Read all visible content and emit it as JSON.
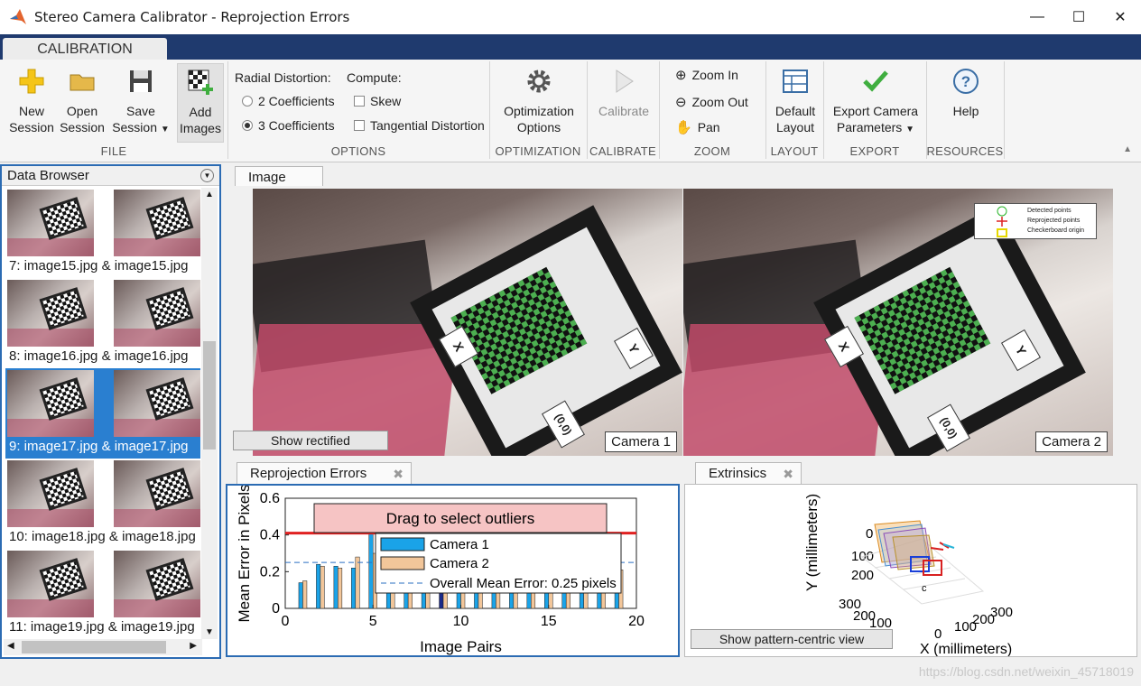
{
  "window": {
    "title": "Stereo Camera Calibrator - Reprojection Errors"
  },
  "tabs": {
    "calibration": "CALIBRATION"
  },
  "ribbon": {
    "new_session": [
      "New",
      "Session"
    ],
    "open_session": [
      "Open",
      "Session"
    ],
    "save_session": [
      "Save",
      "Session"
    ],
    "add_images": [
      "Add",
      "Images"
    ],
    "radial_label": "Radial Distortion:",
    "compute_label": "Compute:",
    "two_coeff": "2 Coefficients",
    "three_coeff": "3 Coefficients",
    "skew": "Skew",
    "tangential": "Tangential Distortion",
    "optimization": [
      "Optimization",
      "Options"
    ],
    "calibrate": "Calibrate",
    "zoom_in": "Zoom In",
    "zoom_out": "Zoom Out",
    "pan": "Pan",
    "default_layout": [
      "Default",
      "Layout"
    ],
    "export": [
      "Export Camera",
      "Parameters"
    ],
    "help": "Help",
    "sections": {
      "file": "FILE",
      "options": "OPTIONS",
      "optimization": "OPTIMIZATION",
      "calibrate": "CALIBRATE",
      "zoom": "ZOOM",
      "layout": "LAYOUT",
      "export": "EXPORT",
      "resources": "RESOURCES"
    },
    "selected_radial": "3 Coefficients"
  },
  "browser": {
    "title": "Data Browser",
    "items": [
      {
        "label": "7: image15.jpg & image15.jpg",
        "selected": false
      },
      {
        "label": "8: image16.jpg & image16.jpg",
        "selected": false
      },
      {
        "label": "9: image17.jpg & image17.jpg",
        "selected": true
      },
      {
        "label": "10: image18.jpg & image18.jpg",
        "selected": false
      },
      {
        "label": "11: image19.jpg & image19.jpg",
        "selected": false
      }
    ]
  },
  "image_panel": {
    "tab": "Image",
    "camera1": "Camera 1",
    "camera2": "Camera 2",
    "show_rectified": "Show rectified",
    "axis_x": "X",
    "axis_y": "Y",
    "origin": "(0,0)",
    "legend": [
      "Detected points",
      "Reprojected points",
      "Checkerboard origin"
    ]
  },
  "reprojection": {
    "tab": "Reprojection Errors",
    "drag_label": "Drag to select outliers"
  },
  "chart_data": {
    "type": "bar",
    "xlabel": "Image Pairs",
    "ylabel": "Mean Error in Pixels",
    "xlim": [
      0,
      20
    ],
    "ylim": [
      0,
      0.6
    ],
    "xticks": [
      0,
      5,
      10,
      15,
      20
    ],
    "yticks": [
      0,
      0.2,
      0.4,
      0.6
    ],
    "categories": [
      1,
      2,
      3,
      4,
      5,
      6,
      7,
      8,
      9,
      10,
      11,
      12,
      13,
      14,
      15,
      16,
      17,
      18,
      19
    ],
    "series": [
      {
        "name": "Camera 1",
        "color": "#1aa3e8",
        "values": [
          0.14,
          0.24,
          0.23,
          0.22,
          0.41,
          0.3,
          0.3,
          0.3,
          0.26,
          0.26,
          0.26,
          0.26,
          0.26,
          0.26,
          0.26,
          0.26,
          0.26,
          0.26,
          0.16
        ]
      },
      {
        "name": "Camera 2",
        "color": "#f2c69a",
        "values": [
          0.15,
          0.23,
          0.22,
          0.28,
          0.3,
          0.3,
          0.3,
          0.3,
          0.26,
          0.26,
          0.26,
          0.26,
          0.26,
          0.26,
          0.26,
          0.26,
          0.26,
          0.26,
          0.21
        ]
      }
    ],
    "overall_mean": 0.25,
    "overall_mean_label": "Overall Mean Error: 0.25 pixels",
    "outlier_threshold": 0.41,
    "selected_pair": 9
  },
  "extrinsics": {
    "tab": "Extrinsics",
    "button": "Show pattern-centric view",
    "ylabel": "Y (millimeters)",
    "xlabel": "X (millimeters)",
    "y_ticks": [
      "0",
      "100",
      "200",
      "300"
    ],
    "z_ticks": [
      "300",
      "200",
      "100",
      "0"
    ],
    "x_ticks": [
      "0",
      "100",
      "200",
      "300"
    ],
    "cam_label": "c"
  },
  "watermark": "https://blog.csdn.net/weixin_45718019"
}
